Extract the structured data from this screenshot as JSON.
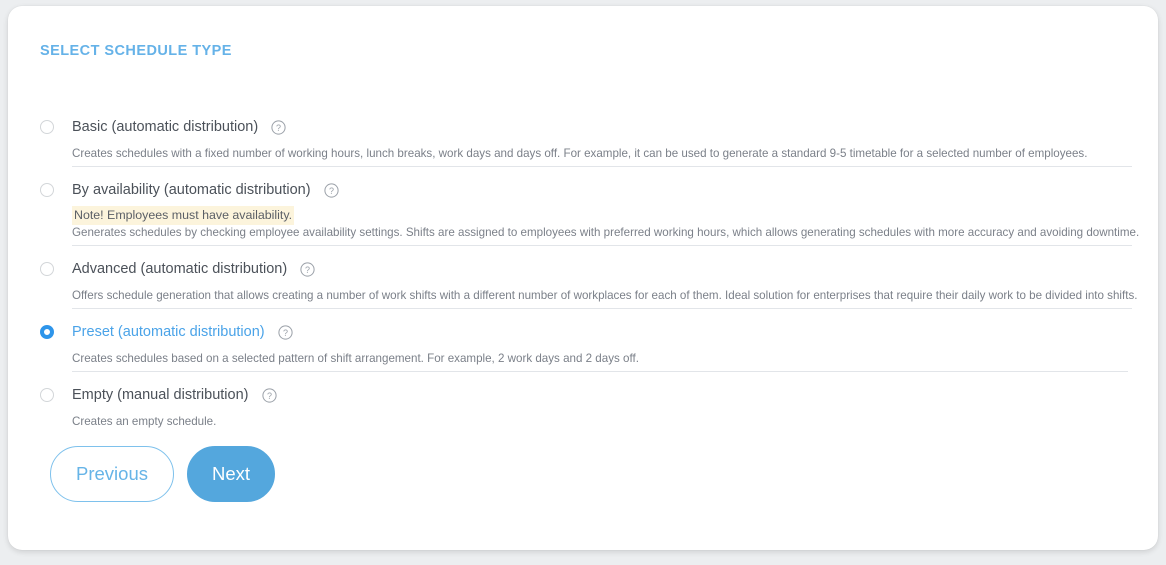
{
  "card": {
    "section_title": "SELECT SCHEDULE TYPE"
  },
  "colors": {
    "accent": "#65b2e8",
    "selected_radio": "#2e95ea",
    "next_button_bg": "#54a7dd",
    "note_bg": "#fcf4dc",
    "page_bg": "#eceef0"
  },
  "options": [
    {
      "label": "Basic (automatic distribution)",
      "selected": false,
      "help_icon": "question-mark-circle-icon",
      "note": null,
      "description": "Creates schedules with a fixed number of working hours, lunch breaks, work days and days off. For example, it can be used to generate a standard 9-5 timetable for a selected number of employees."
    },
    {
      "label": "By availability (automatic distribution)",
      "selected": false,
      "help_icon": "question-mark-circle-icon",
      "note": "Note! Employees must have availability.",
      "description": "Generates schedules by checking employee availability settings. Shifts are assigned to employees with preferred working hours, which allows generating schedules with more accuracy and avoiding downtime."
    },
    {
      "label": "Advanced (automatic distribution)",
      "selected": false,
      "help_icon": "question-mark-circle-icon",
      "note": null,
      "description": "Offers schedule generation that allows creating a number of work shifts with a different number of workplaces for each of them. Ideal solution for enterprises that require their daily work to be divided into shifts."
    },
    {
      "label": "Preset (automatic distribution)",
      "selected": true,
      "help_icon": "question-mark-circle-icon",
      "note": null,
      "description": "Creates schedules based on a selected pattern of shift arrangement. For example, 2 work days and 2 days off."
    },
    {
      "label": "Empty (manual distribution)",
      "selected": false,
      "help_icon": "question-mark-circle-icon",
      "note": null,
      "description": "Creates an empty schedule."
    }
  ],
  "buttons": {
    "previous": "Previous",
    "next": "Next"
  }
}
